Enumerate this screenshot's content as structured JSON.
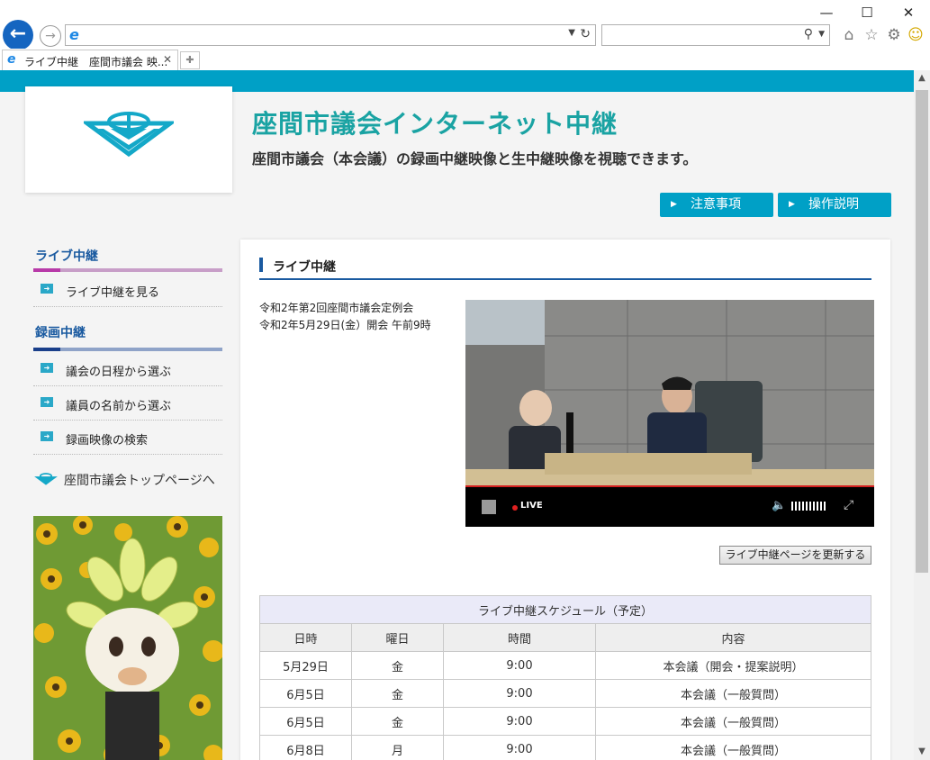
{
  "browser": {
    "tab_title": "ライブ中継　座間市議会 映...",
    "window_controls": [
      "minimize-icon",
      "maximize-icon",
      "close-icon"
    ],
    "toolbar_icons": [
      "home-icon",
      "star-icon",
      "gear-icon",
      "smiley-icon"
    ]
  },
  "header": {
    "title": "座間市議会インターネット中継",
    "subtitle": "座間市議会（本会議）の録画中継映像と生中継映像を視聴できます。",
    "buttons": [
      {
        "label": "注意事項"
      },
      {
        "label": "操作説明"
      }
    ]
  },
  "sidebar": {
    "live_heading": "ライブ中継",
    "live_items": [
      {
        "label": "ライブ中継を見る"
      }
    ],
    "recorded_heading": "録画中継",
    "recorded_items": [
      {
        "label": "議会の日程から選ぶ"
      },
      {
        "label": "議員の名前から選ぶ"
      },
      {
        "label": "録画映像の検索"
      }
    ],
    "top_link": "座間市議会トップページへ"
  },
  "main": {
    "section_title": "ライブ中継",
    "meeting_name": "令和2年第2回座間市議会定例会",
    "meeting_date": "令和2年5月29日(金）開会 午前9時",
    "player": {
      "live_label": "LIVE"
    },
    "refresh_button": "ライブ中継ページを更新する",
    "schedule": {
      "caption": "ライブ中継スケジュール（予定）",
      "headers": [
        "日時",
        "曜日",
        "時間",
        "内容"
      ],
      "rows": [
        [
          "5月29日",
          "金",
          "9:00",
          "本会議（開会・提案説明）"
        ],
        [
          "6月5日",
          "金",
          "9:00",
          "本会議（一般質問）"
        ],
        [
          "6月5日",
          "金",
          "9:00",
          "本会議（一般質問）"
        ],
        [
          "6月8日",
          "月",
          "9:00",
          "本会議（一般質問）"
        ]
      ]
    }
  },
  "colors": {
    "accent": "#00a0c6",
    "title_teal": "#1aa3a3",
    "nav_blue": "#1a5aa0",
    "live_bar": "#c89ec8",
    "recorded_bar": "#8fa3c8"
  }
}
